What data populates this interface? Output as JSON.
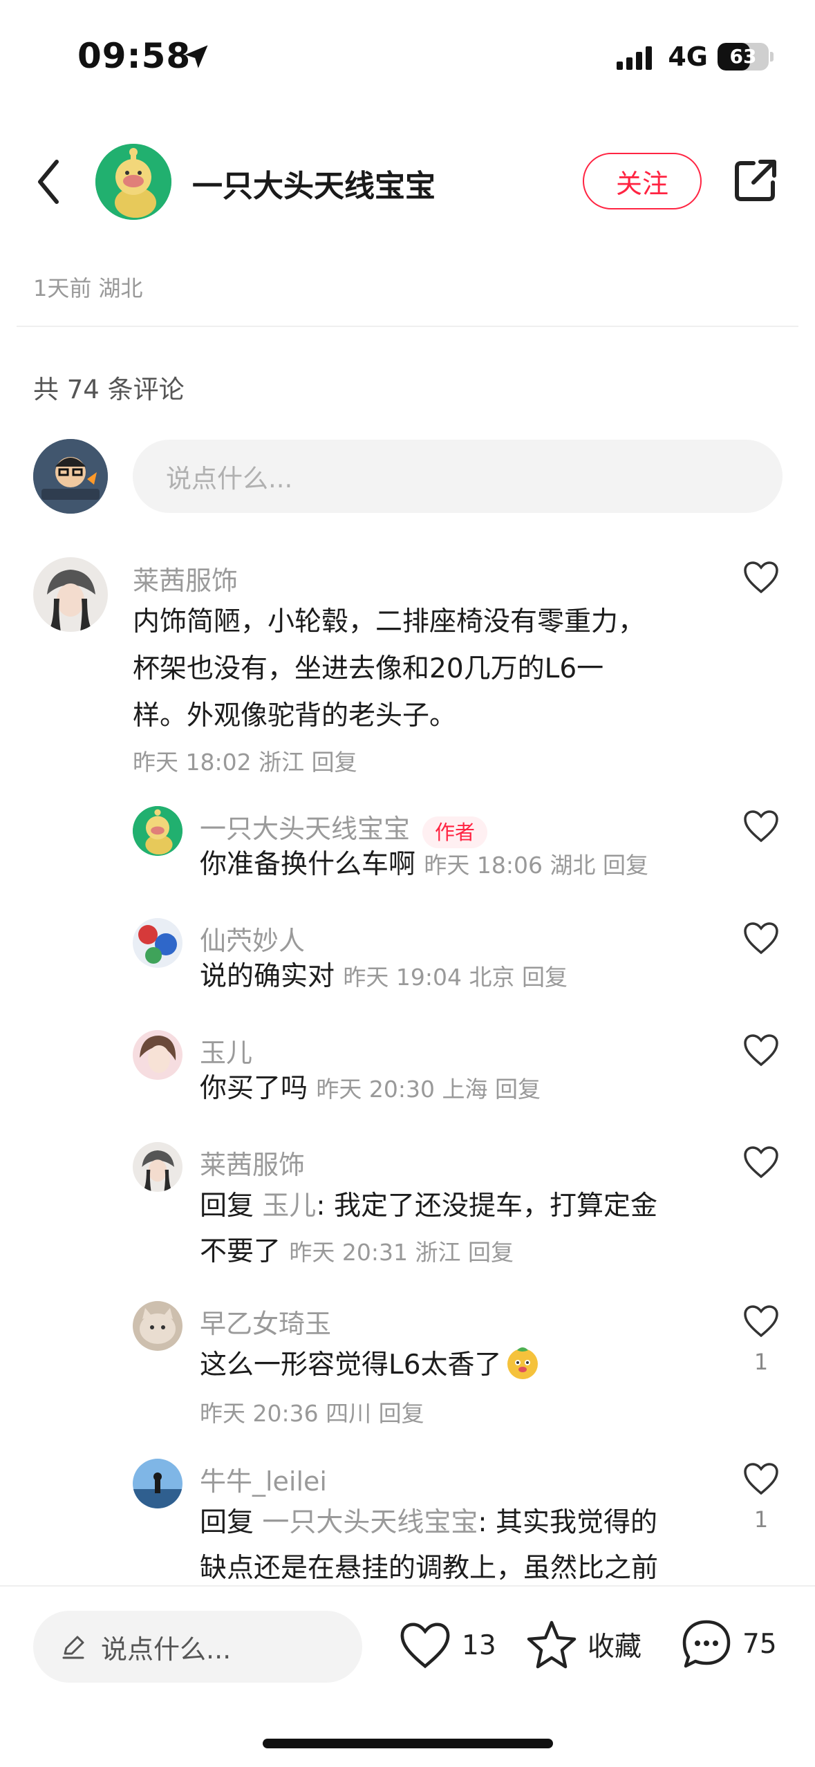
{
  "status_bar": {
    "time": "09:58",
    "network": "4G",
    "battery": "63",
    "battery_level": 0.63
  },
  "header": {
    "author_name": "一只大头天线宝宝",
    "follow_label": "关注"
  },
  "post_meta": {
    "time_location": "1天前 湖北"
  },
  "comments_header": {
    "count_text": "共 74 条评论"
  },
  "comment_input": {
    "placeholder": "说点什么..."
  },
  "comments": [
    {
      "user": "莱茜服饰",
      "lines": [
        "内饰简陋，小轮毂，二排座椅没有零重力，",
        "杯架也没有，坐进去像和20几万的L6一",
        "样。外观像驼背的老头子。"
      ],
      "meta": "昨天 18:02 浙江 回复"
    }
  ],
  "replies": [
    {
      "user": "一只大头天线宝宝",
      "tag": "作者",
      "text": "你准备换什么车啊",
      "meta": "昨天 18:06 湖北 回复"
    },
    {
      "user": "仙茓妙人",
      "text": "说的确实对",
      "meta": "昨天 19:04 北京 回复"
    },
    {
      "user": "玉儿",
      "text": "你买了吗",
      "meta": "昨天 20:30 上海 回复"
    },
    {
      "user": "莱茜服饰",
      "prefix": "回复 ",
      "reply_to": "玉儿",
      "line1_rest": ": 我定了还没提车，打算定金",
      "line2": "不要了",
      "meta": "昨天 20:31 浙江 回复"
    },
    {
      "user": "早乙女琦玉",
      "text": "这么一形容觉得L6太香了",
      "meta": "昨天 20:36 四川 回复",
      "likes": "1"
    },
    {
      "user": "牛牛_leilei",
      "prefix": "回复 ",
      "reply_to": "一只大头天线宝宝",
      "line1_rest": ": 其实我觉得的",
      "line2": "缺点还是在悬挂的调教上，虽然比之前",
      "likes": "1"
    }
  ],
  "bottom_bar": {
    "input_placeholder": "说点什么...",
    "likes": "13",
    "collect_label": "收藏",
    "comments": "75"
  },
  "colors": {
    "accent": "#ff2442",
    "muted": "#999999"
  }
}
